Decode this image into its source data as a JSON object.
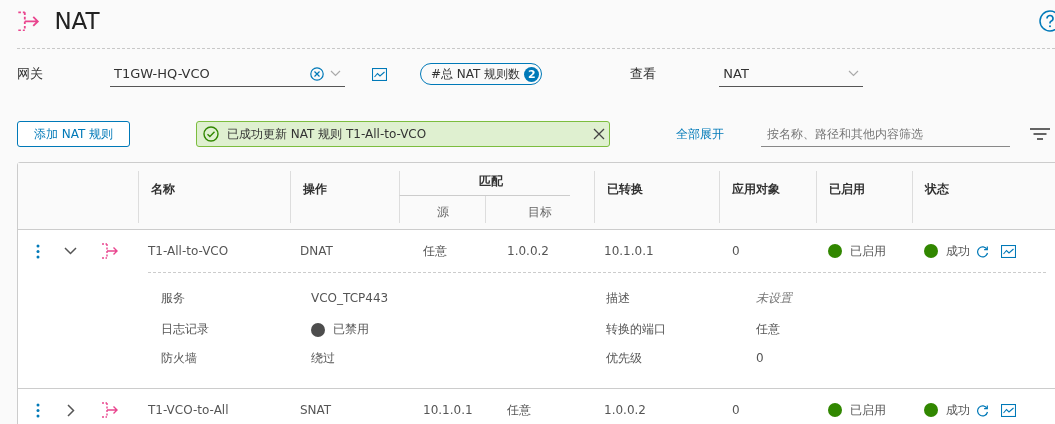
{
  "page": {
    "title": "NAT"
  },
  "gateway": {
    "label": "网关",
    "value": "T1GW-HQ-VCO",
    "rule_count": {
      "label": "#总 NAT 规则数",
      "count": "2"
    }
  },
  "view": {
    "label": "查看",
    "value": "NAT"
  },
  "toolbar": {
    "add_button": "添加 NAT 规则",
    "alert": {
      "kind": "success",
      "message": "已成功更新 NAT 规则 T1-All-to-VCO"
    },
    "expand_all": "全部展开",
    "filter": {
      "placeholder": "按名称、路径和其他内容筛选"
    }
  },
  "table": {
    "columns": [
      {
        "label": "名称"
      },
      {
        "label": "操作"
      },
      {
        "label": "匹配",
        "children": [
          {
            "label": "源"
          },
          {
            "label": "目标"
          }
        ]
      },
      {
        "label": "已转换"
      },
      {
        "label": "应用对象"
      },
      {
        "label": "已启用"
      },
      {
        "label": "状态"
      }
    ],
    "rows": [
      {
        "expanded": true,
        "name": "T1-All-to-VCO",
        "action": "DNAT",
        "source": "任意",
        "destination": "1.0.0.2",
        "translated": "10.1.0.1",
        "applied_to": "0",
        "enabled": {
          "label": "已启用",
          "color": "#318700"
        },
        "status": {
          "label": "成功",
          "color": "#318700"
        },
        "details": [
          {
            "label": "服务",
            "value": "VCO_TCP443",
            "kind": "text"
          },
          {
            "label": "描述",
            "value": "未设置",
            "kind": "unset"
          },
          {
            "label": "日志记录",
            "value": "已禁用",
            "kind": "dot",
            "color": "#4d4d4d"
          },
          {
            "label": "转换的端口",
            "value": "任意",
            "kind": "text"
          },
          {
            "label": "防火墙",
            "value": "绕过",
            "kind": "text"
          },
          {
            "label": "优先级",
            "value": "0",
            "kind": "text"
          }
        ]
      },
      {
        "expanded": false,
        "name": "T1-VCO-to-All",
        "action": "SNAT",
        "source": "10.1.0.1",
        "destination": "任意",
        "translated": "1.0.0.2",
        "applied_to": "0",
        "enabled": {
          "label": "已启用",
          "color": "#318700"
        },
        "status": {
          "label": "成功",
          "color": "#318700"
        }
      }
    ]
  }
}
